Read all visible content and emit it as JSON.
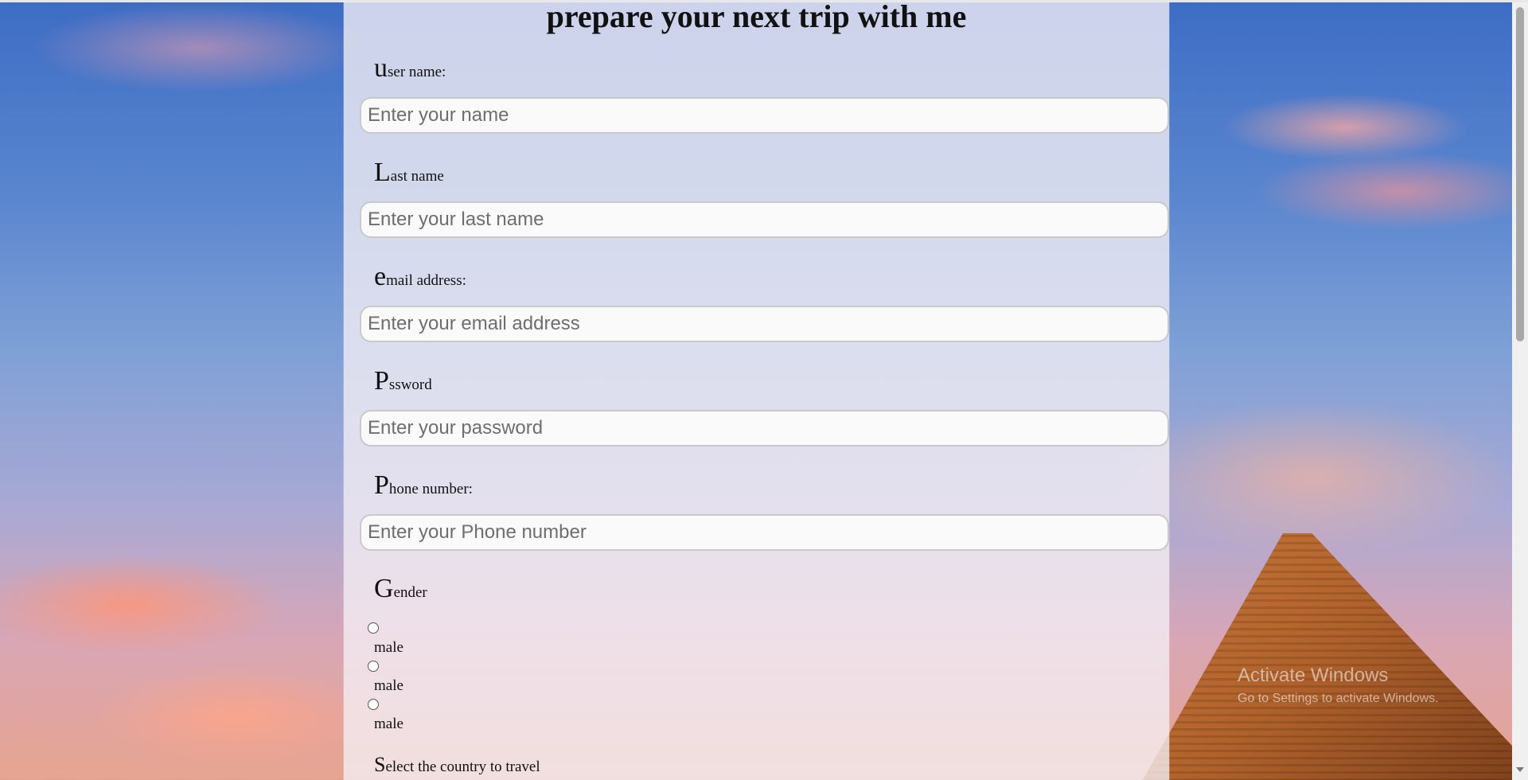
{
  "form": {
    "title": "prepare your next trip with me",
    "fields": [
      {
        "cap": "u",
        "rest": "ser name:",
        "placeholder": "Enter your name"
      },
      {
        "cap": "L",
        "rest": "ast name",
        "placeholder": "Enter your last name"
      },
      {
        "cap": "e",
        "rest": "mail address:",
        "placeholder": "Enter your email address"
      },
      {
        "cap": "P",
        "rest": "ssword",
        "placeholder": "Enter your password"
      },
      {
        "cap": "P",
        "rest": "hone number:",
        "placeholder": "Enter your Phone number"
      }
    ],
    "gender": {
      "cap": "G",
      "rest": "ender",
      "options": [
        "male",
        "male",
        "male"
      ]
    },
    "country": {
      "cap": "S",
      "rest": "elect the country to travel"
    }
  },
  "watermark": {
    "line1": "Activate Windows",
    "line2": "Go to Settings to activate Windows."
  }
}
